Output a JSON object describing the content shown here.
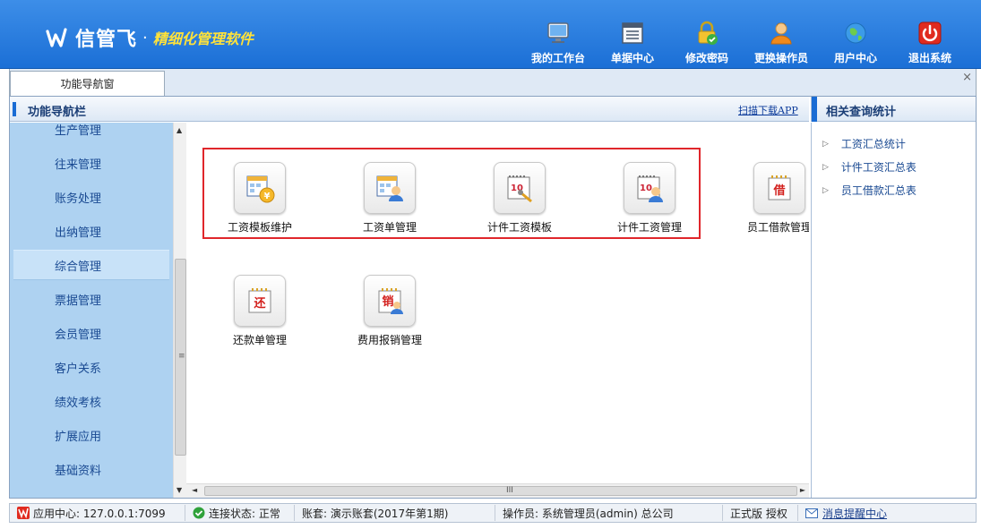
{
  "brand": {
    "name": "信管飞",
    "separator": "·",
    "slogan": "精细化管理软件",
    "accent": "#ffe23a"
  },
  "header_buttons": [
    {
      "label": "我的工作台",
      "icon": "monitor-icon"
    },
    {
      "label": "单据中心",
      "icon": "document-list-icon"
    },
    {
      "label": "修改密码",
      "icon": "lock-icon"
    },
    {
      "label": "更换操作员",
      "icon": "user-icon"
    },
    {
      "label": "用户中心",
      "icon": "globe-icon"
    },
    {
      "label": "退出系统",
      "icon": "power-icon"
    }
  ],
  "tab": {
    "label": "功能导航窗",
    "close": "×"
  },
  "nav": {
    "title": "功能导航栏",
    "scan_link": "扫描下载APP"
  },
  "sidebar": {
    "items": [
      {
        "label": "生产管理"
      },
      {
        "label": "往来管理"
      },
      {
        "label": "账务处理"
      },
      {
        "label": "出纳管理"
      },
      {
        "label": "综合管理",
        "active": true
      },
      {
        "label": "票据管理"
      },
      {
        "label": "会员管理"
      },
      {
        "label": "客户关系"
      },
      {
        "label": "绩效考核"
      },
      {
        "label": "扩展应用"
      },
      {
        "label": "基础资料"
      }
    ]
  },
  "apps": [
    {
      "label": "工资模板维护",
      "icon": "salary-template-icon"
    },
    {
      "label": "工资单管理",
      "icon": "payslip-icon"
    },
    {
      "label": "计件工资模板",
      "icon": "piece-rate-template-icon"
    },
    {
      "label": "计件工资管理",
      "icon": "piece-rate-manage-icon"
    },
    {
      "label": "员工借款管理",
      "icon": "borrow-icon",
      "badge": "借"
    },
    {
      "label": "还款单管理",
      "icon": "repay-icon",
      "badge": "还"
    },
    {
      "label": "费用报销管理",
      "icon": "reimburse-icon",
      "badge": "销"
    }
  ],
  "right_panel": {
    "title": "相关查询统计",
    "links": [
      {
        "label": "工资汇总统计"
      },
      {
        "label": "计件工资汇总表"
      },
      {
        "label": "员工借款汇总表"
      }
    ]
  },
  "hscroll": {
    "grip": "III"
  },
  "vscroll": {
    "grip": "≡"
  },
  "status": {
    "app_center": "应用中心: 127.0.0.1:7099",
    "connection": "连接状态: 正常",
    "account": "账套: 演示账套(2017年第1期)",
    "operator": "操作员: 系统管理员(admin) 总公司",
    "edition": "正式版 授权",
    "message": "消息提醒中心"
  },
  "colors": {
    "header_top": "#3d8ee8",
    "header_bottom": "#1b6fd6",
    "sidebar_bg": "#aed2f1",
    "highlight_border": "#e0262b"
  }
}
